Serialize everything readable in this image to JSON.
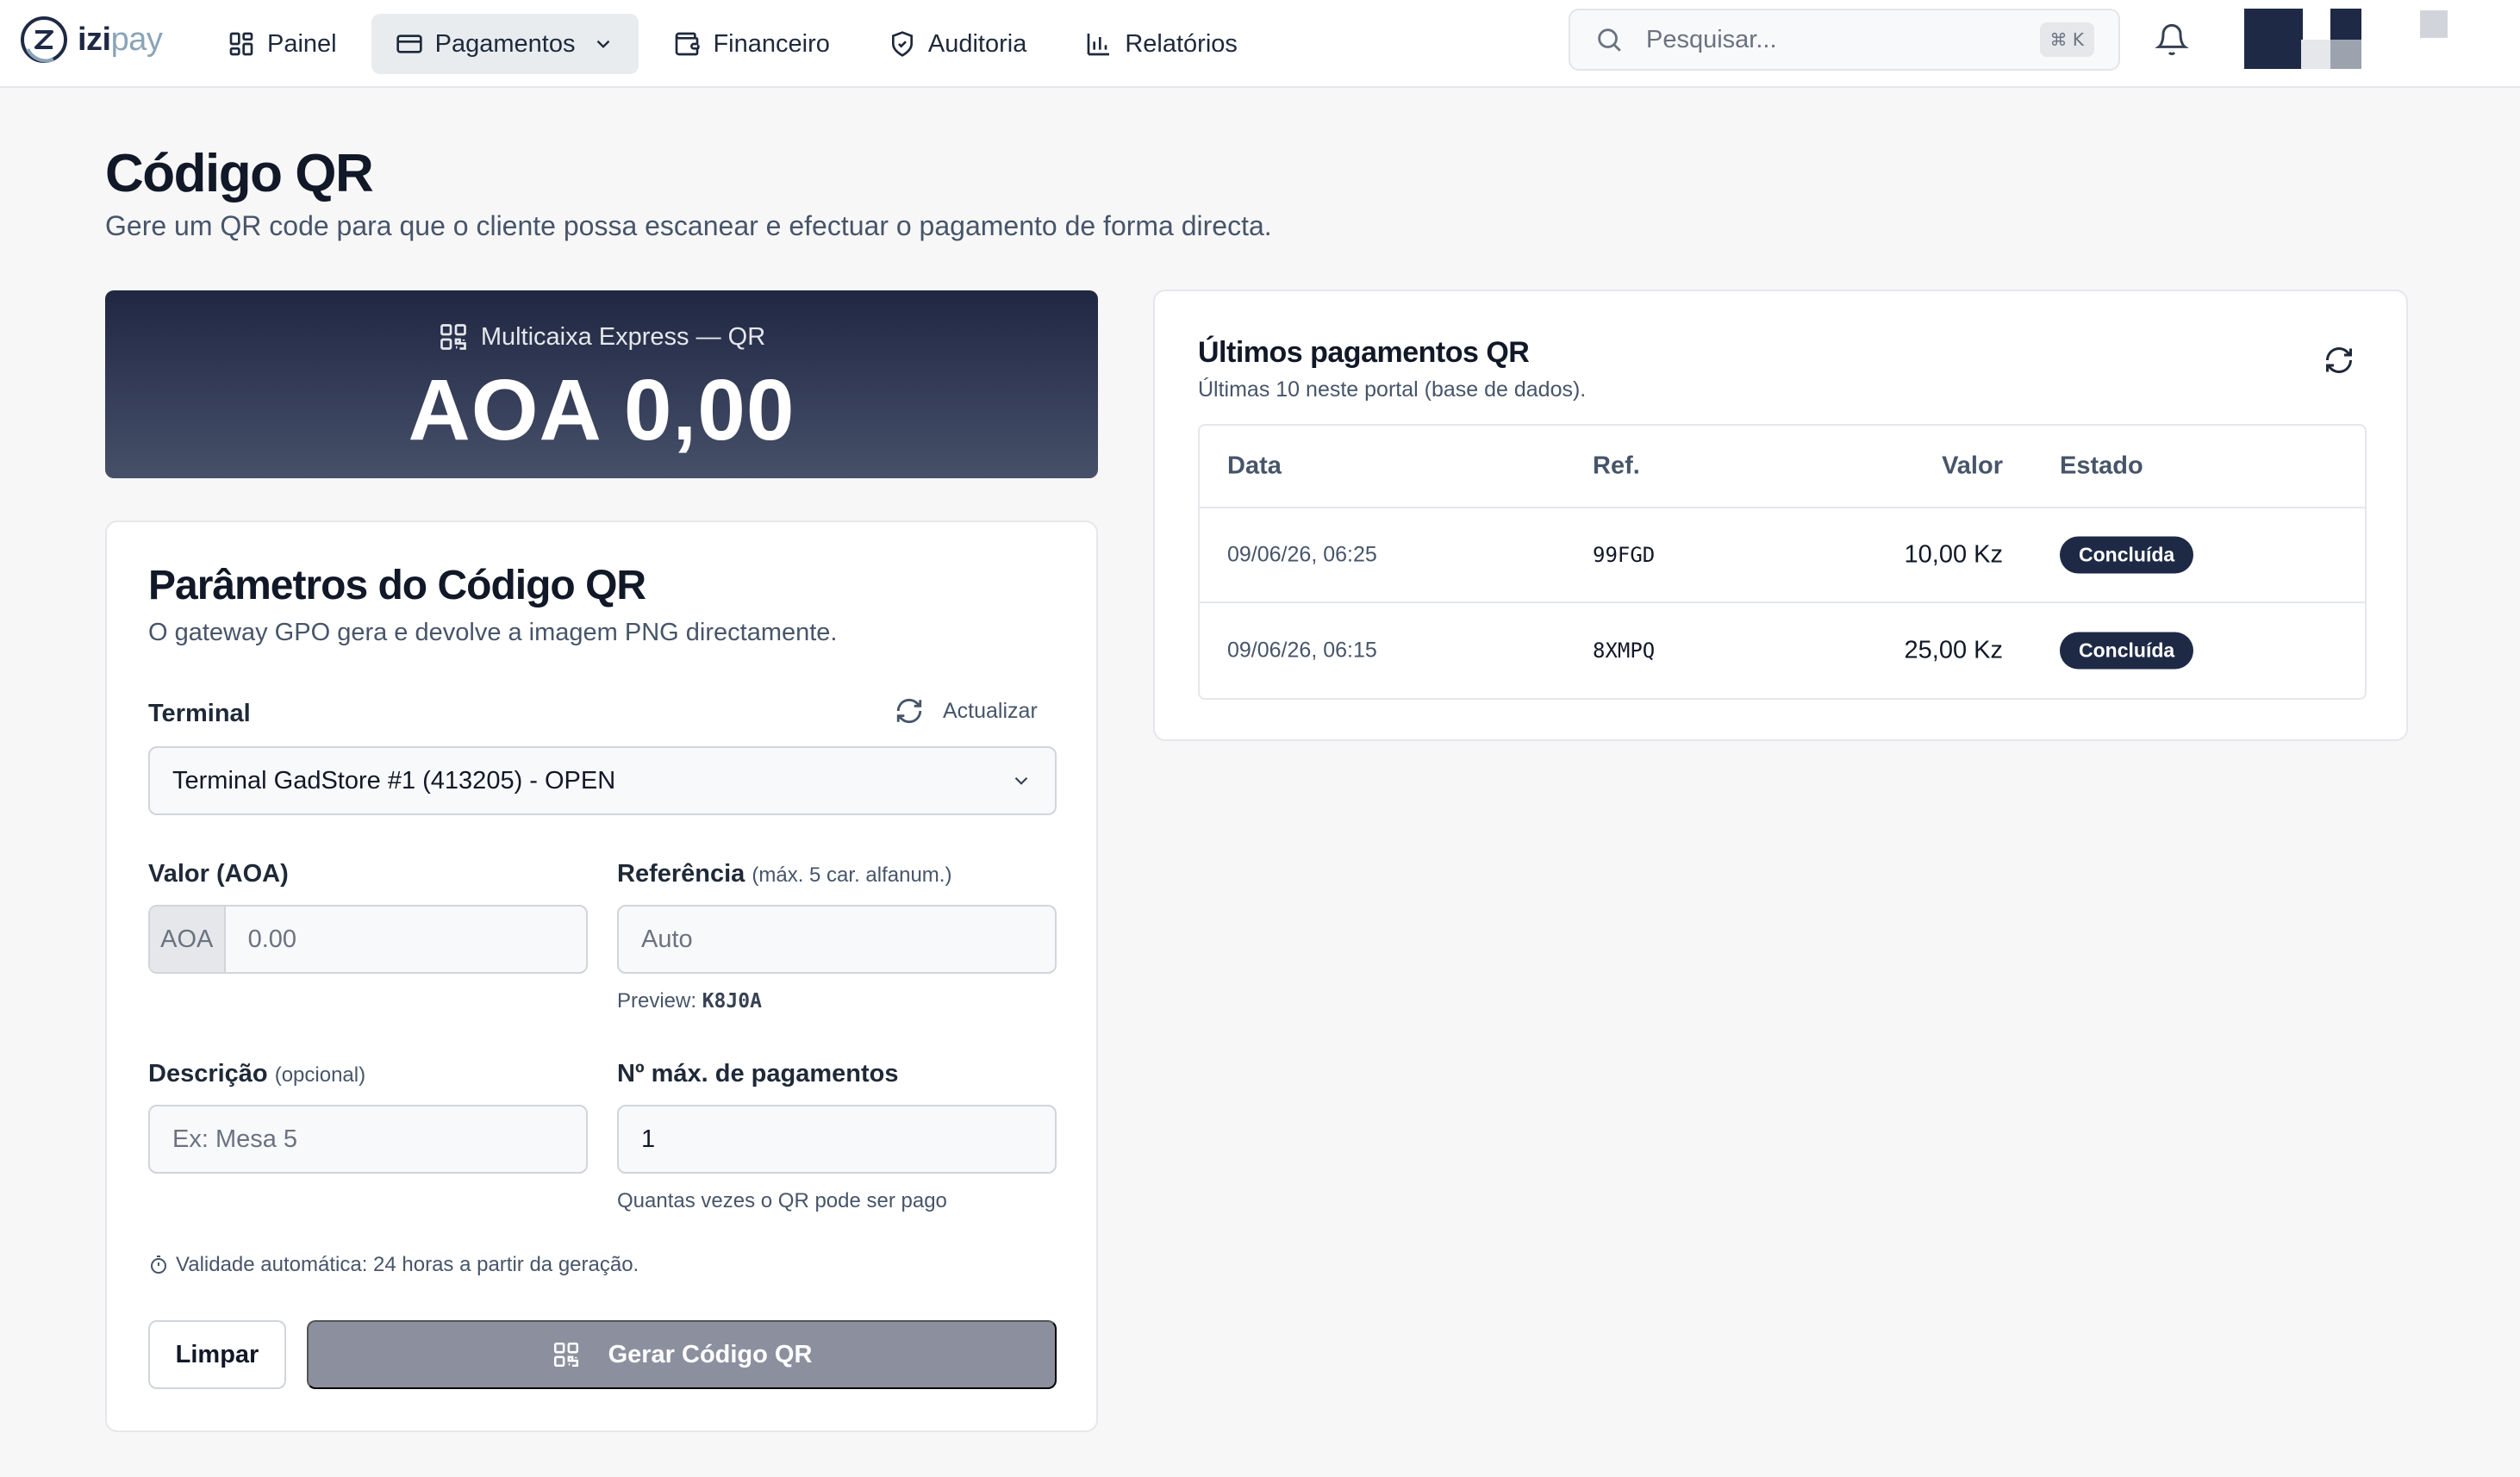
{
  "app": {
    "brand_primary": "izi",
    "brand_secondary": "pay",
    "brand_color": "#1e2a45",
    "accent_color": "#8aa4b8"
  },
  "nav": {
    "items": [
      {
        "label": "Painel",
        "icon": "dashboard-icon"
      },
      {
        "label": "Pagamentos",
        "icon": "credit-card-icon",
        "active": true,
        "has_dropdown": true
      },
      {
        "label": "Financeiro",
        "icon": "wallet-icon"
      },
      {
        "label": "Auditoria",
        "icon": "shield-icon"
      },
      {
        "label": "Relatórios",
        "icon": "bar-chart-icon"
      }
    ]
  },
  "search": {
    "placeholder": "Pesquisar...",
    "shortcut": "⌘ K"
  },
  "page": {
    "title": "Código QR",
    "subtitle": "Gere um QR code para que o cliente possa escanear e efectuar o pagamento de forma directa."
  },
  "banner": {
    "label": "Multicaixa Express — QR",
    "amount": "AOA 0,00"
  },
  "params": {
    "title": "Parâmetros do Código QR",
    "subtitle": "O gateway GPO gera e devolve a imagem PNG directamente.",
    "terminal_label": "Terminal",
    "refresh_label": "Actualizar",
    "terminal_value": "Terminal GadStore #1 (413205) - OPEN",
    "amount_label": "Valor (AOA)",
    "amount_prefix": "AOA",
    "amount_placeholder": "0.00",
    "reference_label": "Referência",
    "reference_hint": "(máx. 5 car. alfanum.)",
    "reference_placeholder": "Auto",
    "preview_label": "Preview:",
    "preview_value": "K8J0A",
    "description_label": "Descrição",
    "description_hint": "(opcional)",
    "description_placeholder": "Ex: Mesa 5",
    "max_payments_label": "Nº máx. de pagamentos",
    "max_payments_value": "1",
    "max_payments_help": "Quantas vezes o QR pode ser pago",
    "validity_text": "Validade automática: 24 horas a partir da geração.",
    "clear_button": "Limpar",
    "generate_button": "Gerar Código QR"
  },
  "recent": {
    "title": "Últimos pagamentos QR",
    "subtitle": "Últimas 10 neste portal (base de dados).",
    "columns": [
      "Data",
      "Ref.",
      "Valor",
      "Estado"
    ],
    "rows": [
      {
        "date": "09/06/26, 06:25",
        "ref": "99FGD",
        "value": "10,00 Kz",
        "status": "Concluída"
      },
      {
        "date": "09/06/26, 06:15",
        "ref": "8XMPQ",
        "value": "25,00 Kz",
        "status": "Concluída"
      }
    ]
  }
}
